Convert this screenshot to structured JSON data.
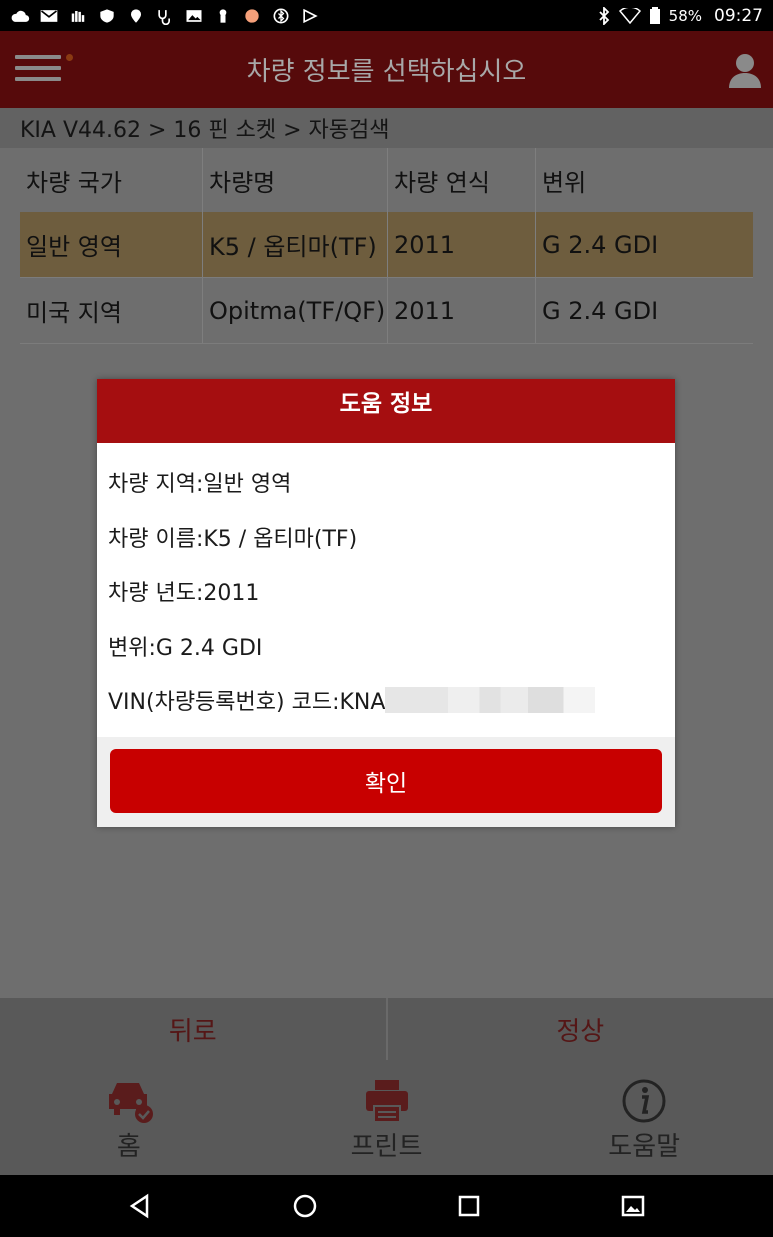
{
  "status_bar": {
    "battery": "58%",
    "time": "09:27"
  },
  "app_bar": {
    "title": "차량 정보를 선택하십시오"
  },
  "breadcrumb": "KIA V44.62 > 16 핀 소켓 > 자동검색",
  "table": {
    "headers": [
      "차량 국가",
      "차량명",
      "차량 연식",
      "변위"
    ],
    "rows": [
      [
        "일반 영역",
        "K5 / 옵티마(TF)",
        "2011",
        "G 2.4 GDI"
      ],
      [
        "미국 지역",
        "Opitma(TF/QF)",
        "2011",
        "G 2.4 GDI"
      ]
    ],
    "selected_row": 0
  },
  "actions": {
    "back": "뒤로",
    "normal": "정상"
  },
  "nav": {
    "home": "홈",
    "print": "프린트",
    "help": "도움말"
  },
  "dialog": {
    "title": "도움 정보",
    "lines": [
      "차량 지역:일반 영역",
      "차량 이름:K5 / 옵티마(TF)",
      "차량 년도:2011",
      "변위:G 2.4 GDI",
      "VIN(차량등록번호) 코드:KNA"
    ],
    "ok": "확인"
  },
  "colors": {
    "header_red": "#a50e10",
    "button_red": "#c80000",
    "selected_row": "#6e5d3e"
  }
}
